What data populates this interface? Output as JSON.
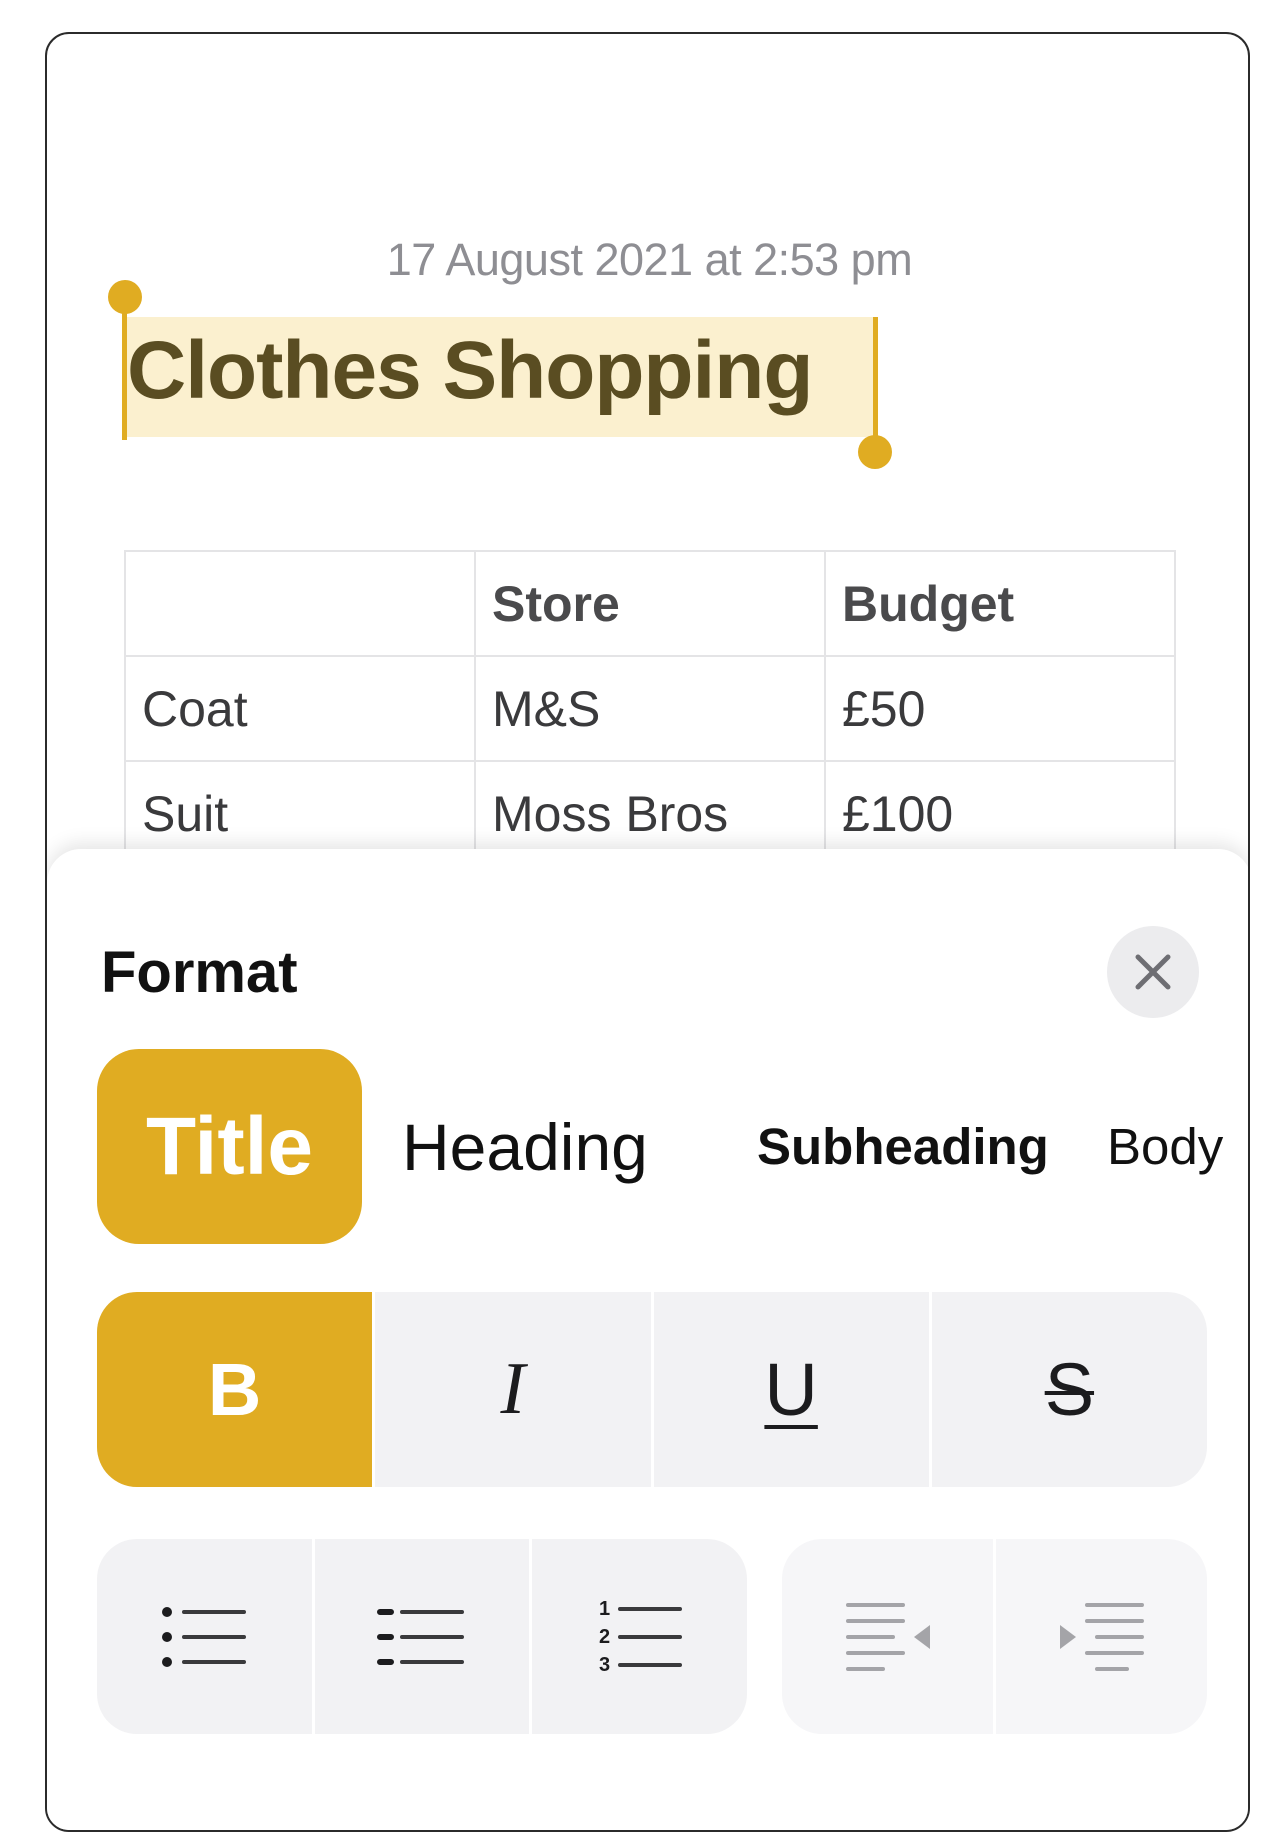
{
  "note": {
    "timestamp": "17 August 2021 at 2:53 pm",
    "title": "Clothes Shopping",
    "table": {
      "headers": [
        "",
        "Store",
        "Budget"
      ],
      "rows": [
        [
          "Coat",
          "M&S",
          "£50"
        ],
        [
          "Suit",
          "Moss Bros",
          "£100"
        ]
      ]
    }
  },
  "format_sheet": {
    "title": "Format",
    "close_icon": "close-icon",
    "styles": [
      "Title",
      "Heading",
      "Subheading",
      "Body"
    ],
    "selected_style": "Title",
    "text_styles": [
      "B",
      "I",
      "U",
      "S"
    ],
    "active_text_style": "B",
    "list_icons": [
      "bulleted-list-icon",
      "dashed-list-icon",
      "numbered-list-icon"
    ],
    "numbered_list_digits": [
      "1",
      "2",
      "3"
    ],
    "indent_icons": [
      "decrease-indent-icon",
      "increase-indent-icon"
    ]
  },
  "colors": {
    "accent": "#e0ac22",
    "selection_highlight": "#fbf0cf",
    "title_text": "#5a4d22"
  }
}
